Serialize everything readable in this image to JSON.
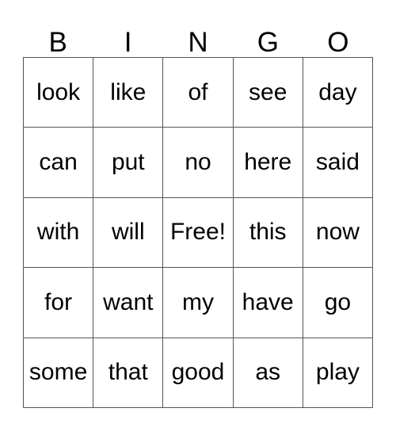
{
  "card": {
    "title": "BINGO",
    "headers": [
      "B",
      "I",
      "N",
      "G",
      "O"
    ],
    "rows": [
      {
        "cells": [
          "look",
          "like",
          "of",
          "see",
          "day"
        ]
      },
      {
        "cells": [
          "can",
          "put",
          "no",
          "here",
          "said"
        ]
      },
      {
        "cells": [
          "with",
          "will",
          "Free!",
          "this",
          "now"
        ]
      },
      {
        "cells": [
          "for",
          "want",
          "my",
          "have",
          "go"
        ]
      },
      {
        "cells": [
          "some",
          "that",
          "good",
          "as",
          "play"
        ]
      }
    ],
    "free_space": {
      "label": "Free!",
      "row": 2,
      "column": 2
    },
    "colors": {
      "background": "#ffffff",
      "text": "#000000",
      "border": "#555555"
    }
  }
}
